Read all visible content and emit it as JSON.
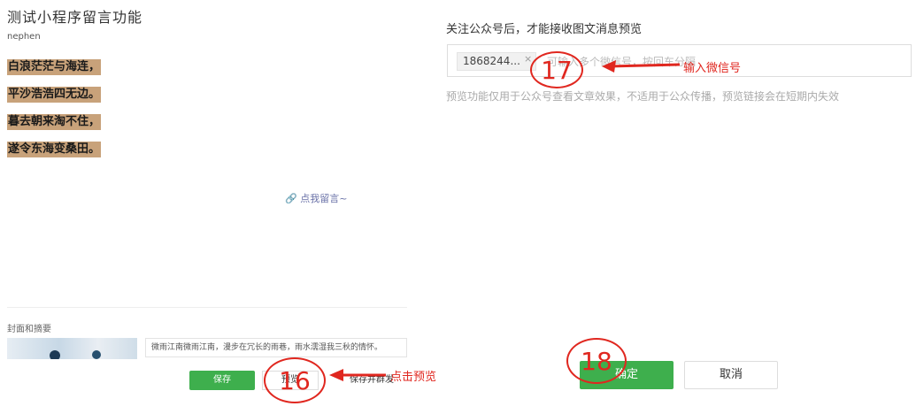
{
  "article": {
    "title": "测试小程序留言功能",
    "author": "nephen",
    "poem": [
      "白浪茫茫与海连，",
      "平沙浩浩四无边。",
      "暮去朝来淘不住，",
      "遂令东海变桑田。"
    ],
    "comment_link": "🔗 点我留言~"
  },
  "cover": {
    "label": "封面和摘要",
    "summary": "微雨江南微雨江南，漫步在冗长的雨巷，雨水濡湿我三秋的情怀。"
  },
  "editor_buttons": {
    "save": "保存",
    "preview": "预览",
    "save_send": "保存并群发"
  },
  "preview_panel": {
    "follow_hint": "关注公众号后，才能接收图文消息预览",
    "wechat_tag": "1868244...",
    "tag_close": "×",
    "input_placeholder": "可输入多个微信号，按回车分隔",
    "note": "预览功能仅用于公众号查看文章效果，不适用于公众传播，预览链接会在短期内失效",
    "ok": "确定",
    "cancel": "取消"
  },
  "annotations": {
    "step16": "16",
    "step17": "17",
    "step18": "18",
    "note17": "输入微信号",
    "note16": "点击预览",
    "color": "#e0271f"
  },
  "colors": {
    "accent_green": "#3eaf4d",
    "poem_highlight": "#c8a27a"
  }
}
